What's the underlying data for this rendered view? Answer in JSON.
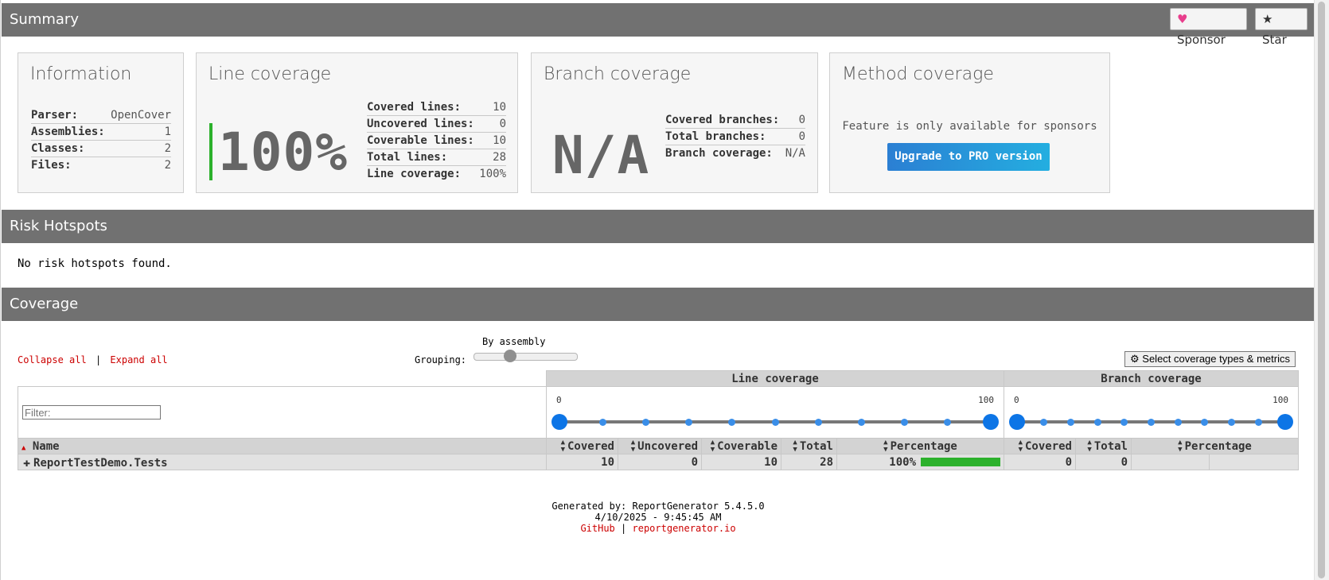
{
  "summary": {
    "title": "Summary",
    "sponsor_label": "Sponsor",
    "star_label": "Star",
    "colors": {
      "header_bg": "#717171",
      "sponsor_heart": "#e83e8c"
    }
  },
  "information": {
    "title": "Information",
    "rows": [
      {
        "k": "Parser:",
        "v": "OpenCover"
      },
      {
        "k": "Assemblies:",
        "v": "1"
      },
      {
        "k": "Classes:",
        "v": "2"
      },
      {
        "k": "Files:",
        "v": "2"
      }
    ]
  },
  "line_coverage": {
    "title": "Line coverage",
    "big_value": "100%",
    "rows": [
      {
        "k": "Covered lines:",
        "v": "10"
      },
      {
        "k": "Uncovered lines:",
        "v": "0"
      },
      {
        "k": "Coverable lines:",
        "v": "10"
      },
      {
        "k": "Total lines:",
        "v": "28"
      },
      {
        "k": "Line coverage:",
        "v": "100%"
      }
    ]
  },
  "branch_coverage": {
    "title": "Branch coverage",
    "big_value": "N/A",
    "rows": [
      {
        "k": "Covered branches:",
        "v": "0"
      },
      {
        "k": "Total branches:",
        "v": "0"
      },
      {
        "k": "Branch coverage:",
        "v": "N/A"
      }
    ]
  },
  "method_coverage": {
    "title": "Method coverage",
    "feature_note": "Feature is only available for sponsors",
    "upgrade_label": "Upgrade to PRO version"
  },
  "risk_hotspots": {
    "title": "Risk Hotspots",
    "message": "No risk hotspots found."
  },
  "coverage": {
    "title": "Coverage",
    "collapse_all": "Collapse all",
    "separator": "|",
    "expand_all": "Expand all",
    "grouping_label": "Grouping:",
    "grouping_value": "By assembly",
    "grouping_level": 0.33,
    "select_metrics_label": "Select coverage types & metrics",
    "filter_placeholder": "Filter:",
    "line_group_header": "Line coverage",
    "branch_group_header": "Branch coverage",
    "line_range": {
      "min": "0",
      "max": "100"
    },
    "branch_range": {
      "min": "0",
      "max": "100"
    },
    "columns": {
      "name": "Name",
      "covered": "Covered",
      "uncovered": "Uncovered",
      "coverable": "Coverable",
      "total": "Total",
      "percentage": "Percentage",
      "b_covered": "Covered",
      "b_total": "Total",
      "b_percentage": "Percentage"
    },
    "rows": [
      {
        "name": "ReportTestDemo.Tests",
        "covered": "10",
        "uncovered": "0",
        "coverable": "10",
        "total": "28",
        "percentage": "100%",
        "percentage_fill": 1.0,
        "b_covered": "0",
        "b_total": "0",
        "b_percentage": ""
      }
    ]
  },
  "footer": {
    "generated_by": "Generated by: ReportGenerator 5.4.5.0",
    "timestamp": "4/10/2025 - 9:45:45 AM",
    "github": "GitHub",
    "separator": "|",
    "site": "reportgenerator.io"
  }
}
